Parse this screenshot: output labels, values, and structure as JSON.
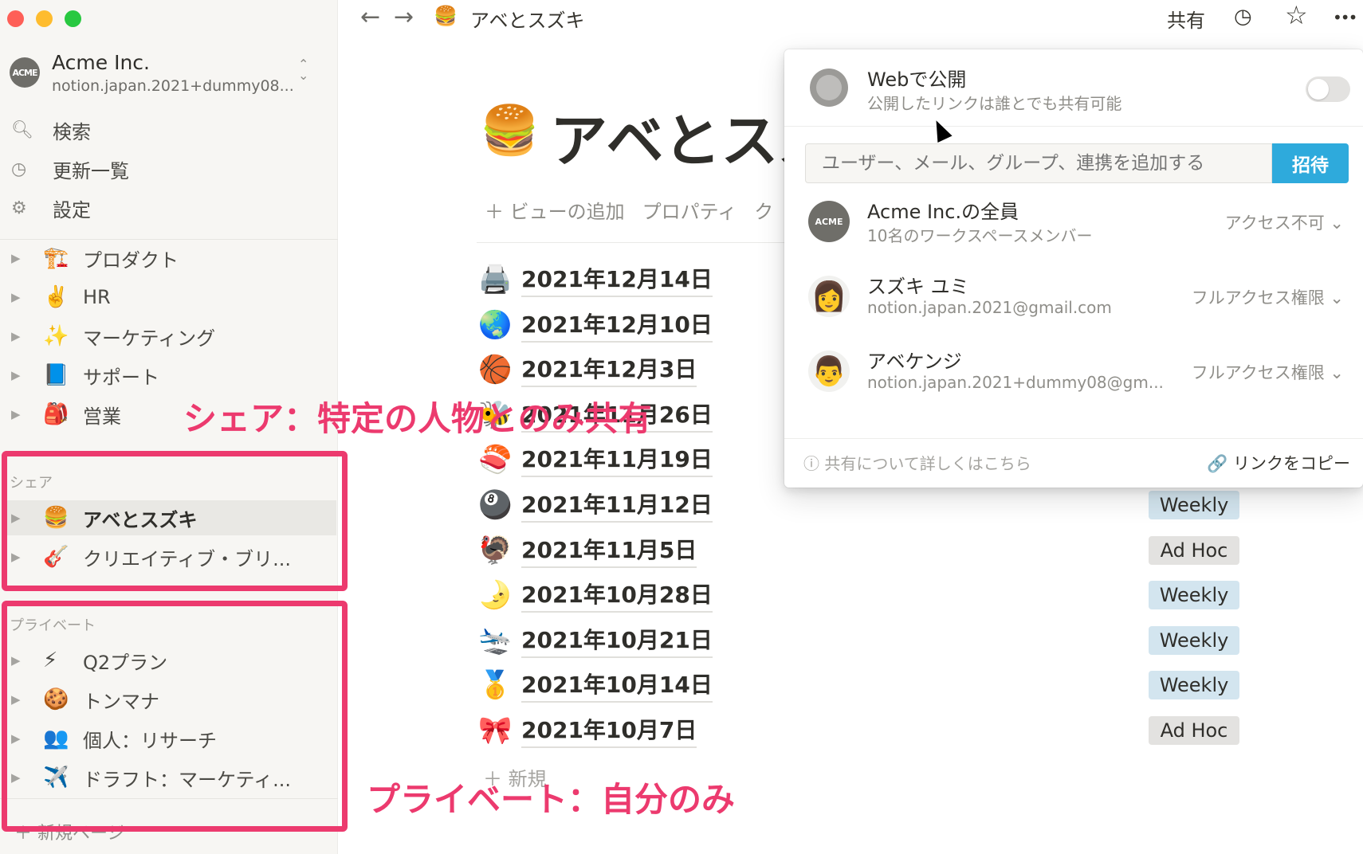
{
  "workspace": {
    "logo": "ACME",
    "name": "Acme Inc.",
    "email": "notion.japan.2021+dummy08...",
    "toggle_icon": "chevron-up-down-icon"
  },
  "sidebar_nav": [
    {
      "icon": "search-icon",
      "label": "検索"
    },
    {
      "icon": "clock-icon",
      "label": "更新一覧"
    },
    {
      "icon": "gear-icon",
      "label": "設定"
    }
  ],
  "workspace_pages": [
    {
      "emoji": "🏗️",
      "label": "プロダクト"
    },
    {
      "emoji": "✌️",
      "label": "HR"
    },
    {
      "emoji": "✨",
      "label": "マーケティング"
    },
    {
      "emoji": "📘",
      "label": "サポート"
    },
    {
      "emoji": "🎒",
      "label": "営業"
    }
  ],
  "shared_section": {
    "heading": "シェア",
    "items": [
      {
        "emoji": "🍔",
        "label": "アベとスズキ"
      },
      {
        "emoji": "🎸",
        "label": "クリエイティブ・ブリ..."
      }
    ]
  },
  "private_section": {
    "heading": "プライベート",
    "items": [
      {
        "emoji": "⚡",
        "label": "Q2プラン"
      },
      {
        "emoji": "🍪",
        "label": "トンマナ"
      },
      {
        "emoji": "👥",
        "label": "個人：リサーチ"
      },
      {
        "emoji": "✈️",
        "label": "ドラフト：マーケティ..."
      }
    ]
  },
  "new_page_label": "＋ 新規ページ",
  "topbar": {
    "back_icon": "←",
    "forward_icon": "→",
    "page_emoji": "🍔",
    "page_title": "アベとスズキ",
    "share_label": "共有",
    "history_icon": "🕘",
    "favorite_icon": "☆",
    "more_icon": "•••"
  },
  "page": {
    "emoji": "🍔",
    "title": "アベとスズキ",
    "view_add": "＋ ビューの追加",
    "properties": "プロパティ",
    "cut_off": "ク"
  },
  "rows": [
    {
      "emoji": "🖨️",
      "date": "2021年12月14日",
      "tag": ""
    },
    {
      "emoji": "🌏",
      "date": "2021年12月10日",
      "tag": ""
    },
    {
      "emoji": "🏀",
      "date": "2021年12月3日",
      "tag": ""
    },
    {
      "emoji": "🐝",
      "date": "2021年11月26日",
      "tag": ""
    },
    {
      "emoji": "🍣",
      "date": "2021年11月19日",
      "tag": ""
    },
    {
      "emoji": "🎱",
      "date": "2021年11月12日",
      "tag": "Weekly"
    },
    {
      "emoji": "🦃",
      "date": "2021年11月5日",
      "tag": "Ad Hoc"
    },
    {
      "emoji": "🌛",
      "date": "2021年10月28日",
      "tag": "Weekly"
    },
    {
      "emoji": "🛬",
      "date": "2021年10月21日",
      "tag": "Weekly"
    },
    {
      "emoji": "🥇",
      "date": "2021年10月14日",
      "tag": "Weekly"
    },
    {
      "emoji": "🎀",
      "date": "2021年10月7日",
      "tag": "Ad Hoc"
    }
  ],
  "new_row_label": "＋ 新規",
  "share_popover": {
    "web_title": "Webで公開",
    "web_subtitle": "公開したリンクは誰とでも共有可能",
    "invite_placeholder": "ユーザー、メール、グループ、連携を追加する",
    "invite_button": "招待",
    "members": [
      {
        "avatar": "ACME",
        "name": "Acme Inc.の全員",
        "detail": "10名のワークスペースメンバー",
        "access": "アクセス不可 ⌄"
      },
      {
        "avatar": "👩",
        "name": "スズキ ユミ",
        "detail": "notion.japan.2021@gmail.com",
        "access": "フルアクセス権限 ⌄"
      },
      {
        "avatar": "👨",
        "name": "アベケンジ",
        "detail": "notion.japan.2021+dummy08@gm...",
        "access": "フルアクセス権限 ⌄"
      }
    ],
    "help_link": "ⓘ 共有について詳しくはこちら",
    "copy_link": "🔗 リンクをコピー"
  },
  "annotations": {
    "share_note": "シェア：特定の人物とのみ共有",
    "private_note": "プライベート：自分のみ",
    "color": "#ec3a6e"
  },
  "colors": {
    "close": "#fe5f57",
    "minimize": "#febc2e",
    "maximize": "#28c840",
    "invite_button": "#2eaadc",
    "weekly_tag": "#d3e5ef",
    "adhoc_tag": "#e3e2e0"
  }
}
